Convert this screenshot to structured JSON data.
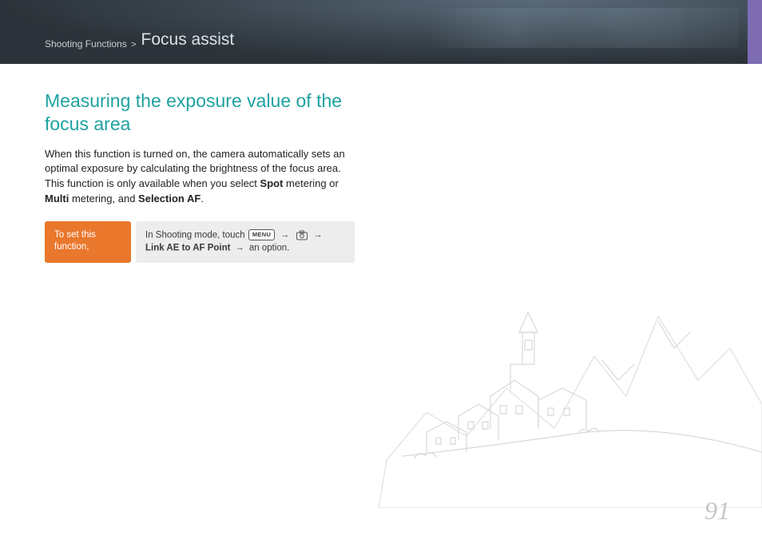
{
  "header": {
    "breadcrumb_category": "Shooting Functions",
    "breadcrumb_sep": ">",
    "section": "Focus assist"
  },
  "content": {
    "heading": "Measuring the exposure value of the focus area",
    "body_pre": "When this function is turned on, the camera automatically sets an optimal exposure by calculating the brightness of the focus area. This function is only available when you select ",
    "spot": "Spot",
    "body_mid1": " metering or ",
    "multi": "Multi",
    "body_mid2": " metering, and ",
    "selection_af": "Selection AF",
    "body_end": "."
  },
  "instruction": {
    "label": "To set this function,",
    "lead": "In Shooting mode, touch ",
    "menu_label": "MENU",
    "arrow": "→",
    "link_option": "Link AE to AF Point",
    "tail": " an option."
  },
  "page_number": "91"
}
